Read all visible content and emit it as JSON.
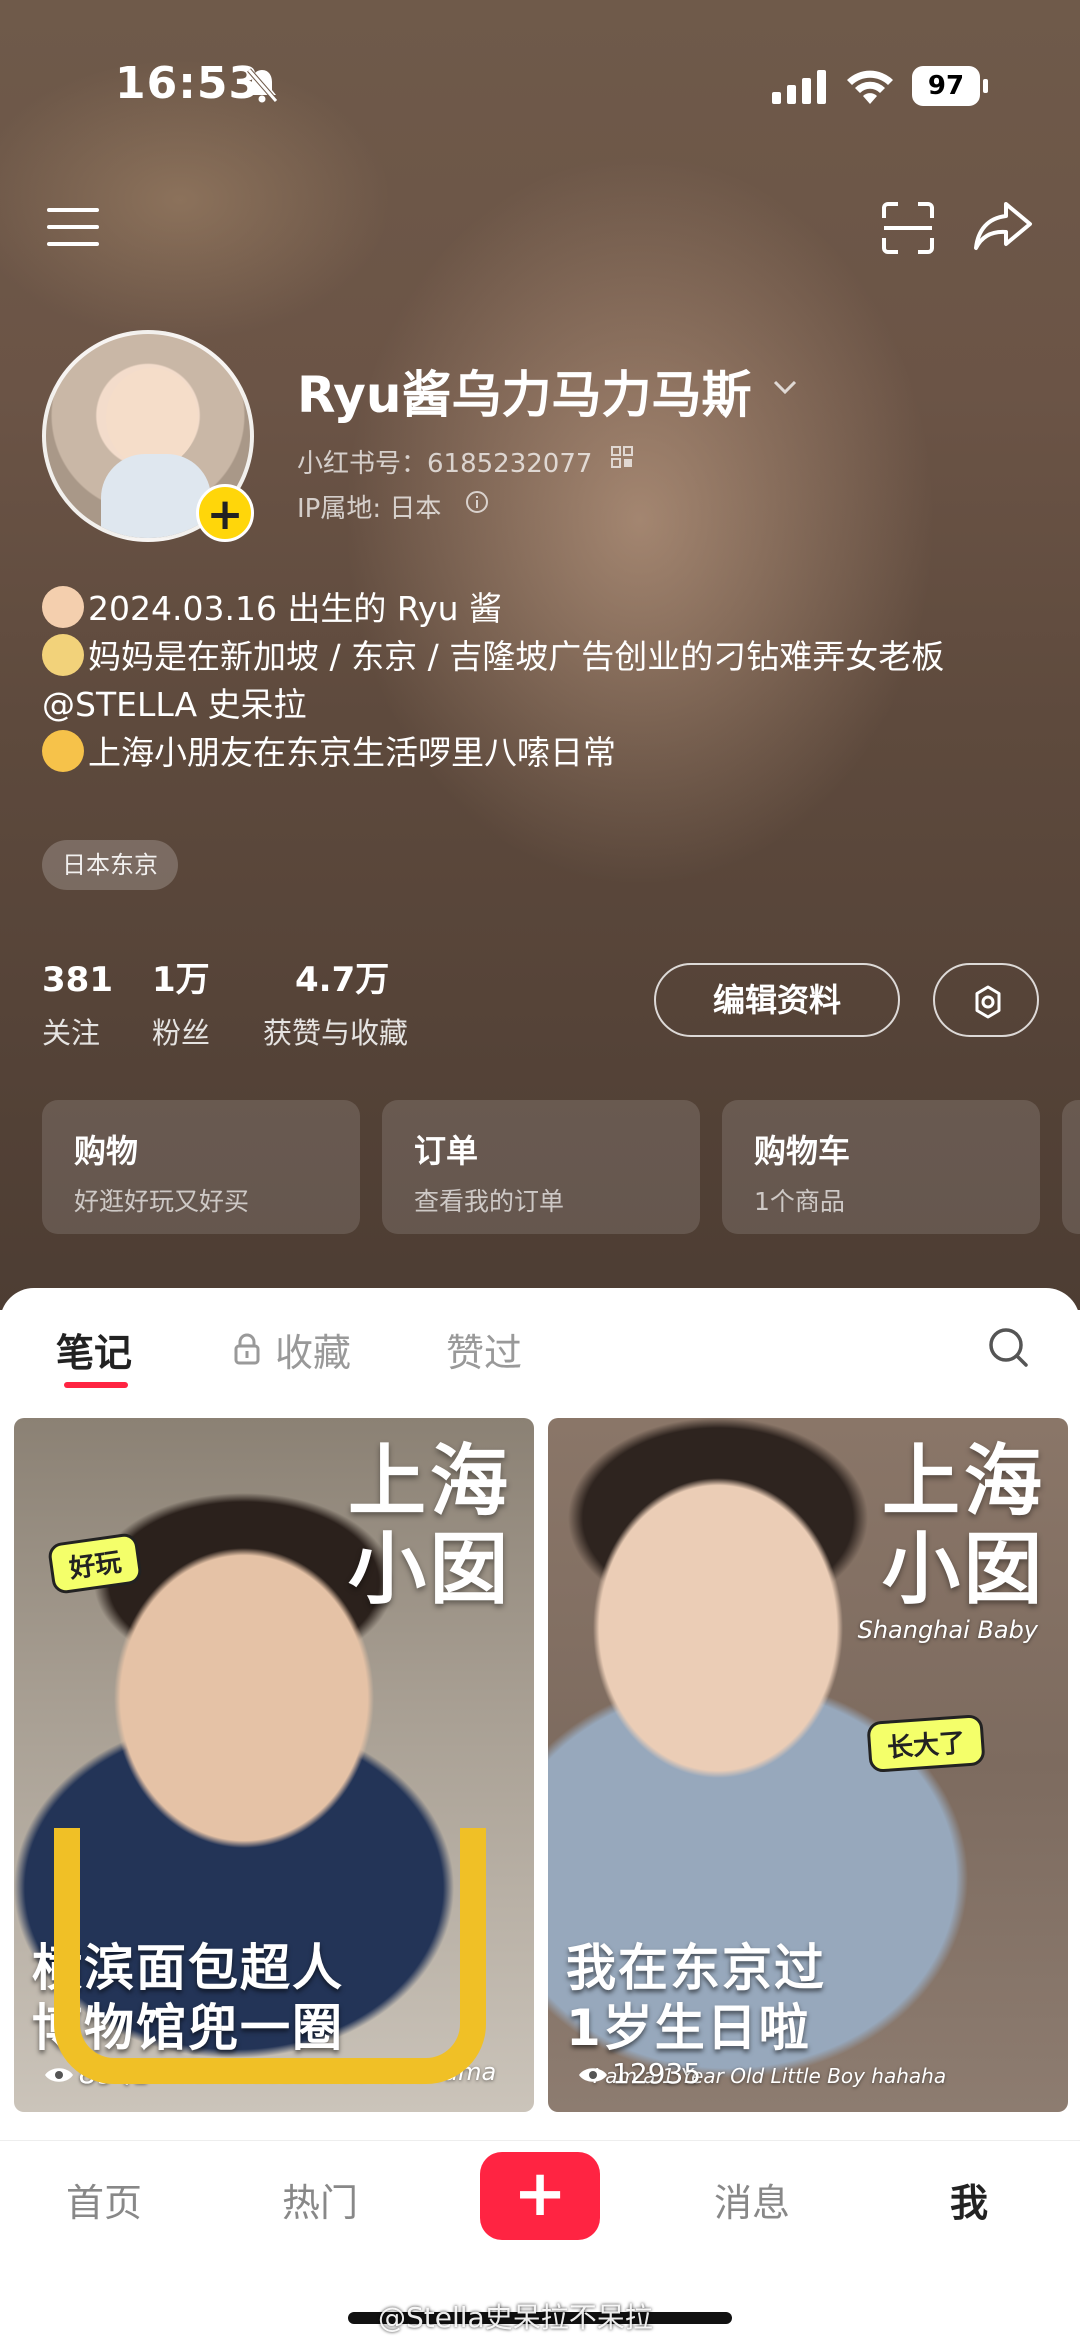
{
  "status_bar": {
    "time": "16:53",
    "battery": "97"
  },
  "profile": {
    "nickname": "Ryu酱乌力马力马斯",
    "red_id": "小红书号：6185232077",
    "ip_location": "IP属地: 日本",
    "bio_lines": [
      "2024.03.16 出生的 Ryu 酱",
      "妈妈是在新加坡 / 东京 / 吉隆坡广告创业的刁钻难弄女老板",
      "@STELLA 史呆拉",
      "上海小朋友在东京生活啰里八嗦日常"
    ],
    "tag": "日本东京"
  },
  "stats": [
    {
      "num": "381",
      "label": "关注"
    },
    {
      "num": "1万",
      "label": "粉丝"
    },
    {
      "num": "4.7万",
      "label": "获赞与收藏"
    }
  ],
  "buttons": {
    "edit_profile": "编辑资料"
  },
  "cards": [
    {
      "title": "购物",
      "subtitle": "好逛好玩又好买"
    },
    {
      "title": "订单",
      "subtitle": "查看我的订单"
    },
    {
      "title": "购物车",
      "subtitle": "1个商品"
    }
  ],
  "tabs": [
    {
      "label": "笔记"
    },
    {
      "label": "收藏"
    },
    {
      "label": "赞过"
    }
  ],
  "notes": [
    {
      "big_title": "上海\n小囡",
      "sticker": "好玩",
      "caption_line1": "横滨面包超人",
      "caption_line2": "博物馆兜一圈",
      "en_caption": "Anpanman Museum at Yokohama",
      "views": "8941"
    },
    {
      "big_title": "上海\n小囡",
      "en_title": "Shanghai Baby",
      "sticker": "长大了",
      "caption_line1": "我在东京过",
      "caption_line2": "1岁生日啦",
      "en_caption": "I am a 1 Year Old Little Boy hahaha",
      "views": "12935"
    }
  ],
  "bottom_nav": [
    {
      "label": "首页"
    },
    {
      "label": "热门"
    },
    {
      "label": "消息"
    },
    {
      "label": "我"
    }
  ],
  "publish_label": "+",
  "watermark": "@Stella史呆拉不呆拉",
  "colors": {
    "accent": "#ff2442",
    "badge": "#ffd60a"
  }
}
